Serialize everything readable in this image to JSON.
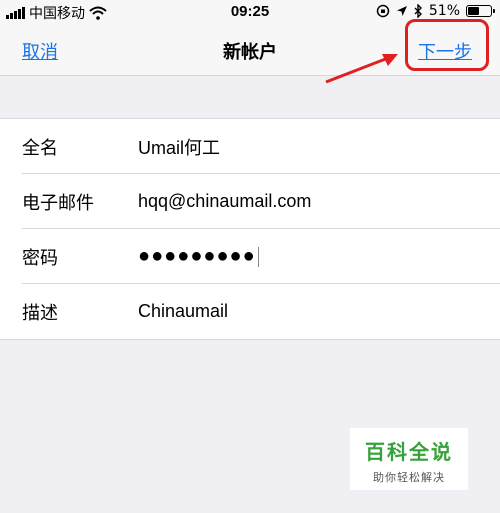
{
  "status_bar": {
    "carrier": "中国移动",
    "time": "09:25",
    "battery_text": "51%",
    "battery_level": 0.51,
    "icons": [
      "signal-icon",
      "wifi-icon",
      "orientation-lock-icon",
      "location-icon",
      "bluetooth-icon",
      "battery-icon"
    ]
  },
  "nav": {
    "cancel_label": "取消",
    "title": "新帐户",
    "next_label": "下一步"
  },
  "form": {
    "rows": [
      {
        "label": "全名",
        "value": "Umail何工"
      },
      {
        "label": "电子邮件",
        "value": "hqq@chinaumail.com"
      },
      {
        "label": "密码",
        "value": "●●●●●●●●●"
      },
      {
        "label": "描述",
        "value": "Chinaumail"
      }
    ]
  },
  "watermark": {
    "main": "百科全说",
    "sub": "助你轻松解决"
  },
  "colors": {
    "link": "#1a73e8",
    "highlight_red": "#e02020",
    "highlight_yellow": "#fbfa8c",
    "watermark_green": "#37a23a"
  }
}
